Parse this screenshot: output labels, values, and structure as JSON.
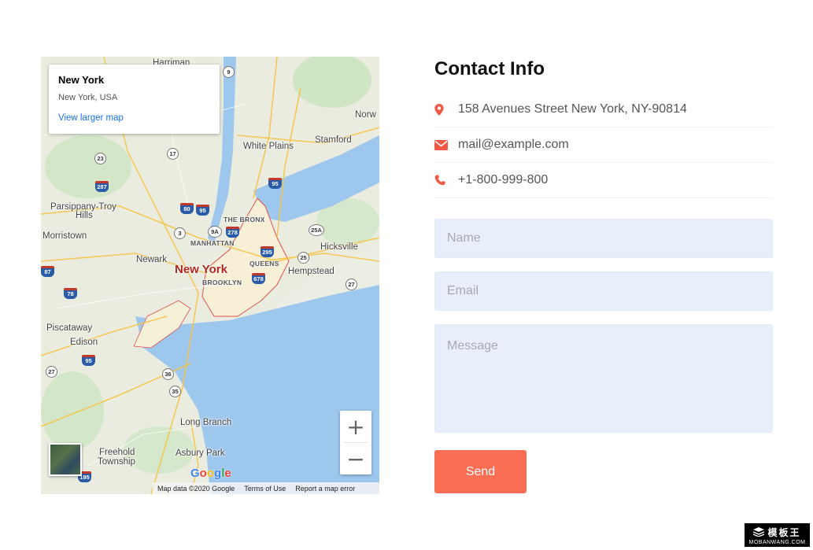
{
  "map": {
    "info_card": {
      "title": "New York",
      "subtitle": "New York, USA",
      "link": "View larger map"
    },
    "places": {
      "harriman": "Harriman",
      "norw": "Norw",
      "white_plains": "White Plains",
      "stamford": "Stamford",
      "parsippany": "Parsippany-Troy",
      "hills": "Hills",
      "morristown": "Morristown",
      "the_bronx": "THE BRONX",
      "manhattan": "MANHATTAN",
      "queens": "QUEENS",
      "brooklyn": "BROOKLYN",
      "newark": "Newark",
      "new_york": "New York",
      "hicksville": "Hicksville",
      "hempstead": "Hempstead",
      "piscataway": "Piscataway",
      "edison": "Edison",
      "long_branch": "Long Branch",
      "freehold": "Freehold",
      "township": "Township",
      "asbury_park": "Asbury Park"
    },
    "shields": {
      "s9": "9",
      "s23": "23",
      "s17": "17",
      "s287": "287",
      "s95a": "95",
      "s80": "80",
      "s95b": "95",
      "s3": "3",
      "s9a": "9A",
      "s278": "278",
      "s295": "295",
      "s25a": "25A",
      "s25": "25",
      "s678": "678",
      "s27a": "27",
      "s87": "87",
      "s78": "78",
      "s95c": "95",
      "s27b": "27",
      "s36": "36",
      "s35": "35",
      "s195": "195"
    },
    "zoom_in": "+",
    "zoom_out": "−",
    "google_logo": [
      "G",
      "o",
      "o",
      "g",
      "l",
      "e"
    ],
    "attribution": {
      "data": "Map data ©2020 Google",
      "terms": "Terms of Use",
      "report": "Report a map error"
    }
  },
  "contact": {
    "title": "Contact Info",
    "address": "158 Avenues Street New York, NY-90814",
    "email": "mail@example.com",
    "phone": "+1-800-999-800",
    "form": {
      "name_placeholder": "Name",
      "email_placeholder": "Email",
      "message_placeholder": "Message",
      "send_label": "Send"
    }
  },
  "watermark": {
    "cn": "模板王",
    "en": "MOBANWANG.COM"
  },
  "colors": {
    "accent": "#fa6e53",
    "icon": "#f05a45",
    "field_bg": "#e8effb",
    "link": "#1a73e8"
  }
}
